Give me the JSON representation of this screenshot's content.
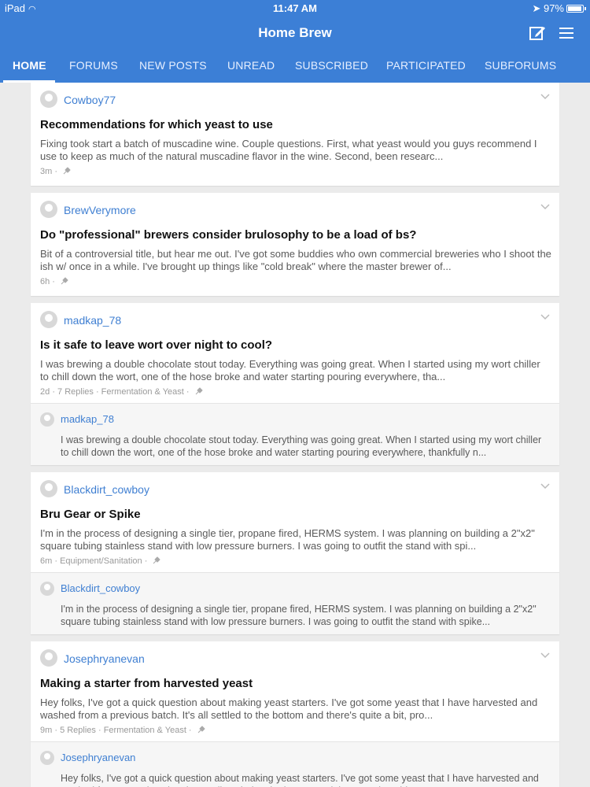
{
  "status_bar": {
    "device": "iPad",
    "time": "11:47 AM",
    "battery": "97%"
  },
  "header": {
    "title": "Home Brew"
  },
  "tabs": [
    "HOME",
    "FORUMS",
    "NEW POSTS",
    "UNREAD",
    "SUBSCRIBED",
    "PARTICIPATED",
    "SUBFORUMS"
  ],
  "posts": [
    {
      "user": "Cowboy77",
      "title": "Recommendations for which yeast to use",
      "preview": "Fixing took start a batch of muscadine wine. Couple questions. First, what yeast would you guys recommend I use to keep as much of the natural muscadine flavor in the wine. Second, been researc...",
      "time": "3m",
      "meta_extra": ""
    },
    {
      "user": "BrewVerymore",
      "title": "Do \"professional\" brewers consider brulosophy to be a load of bs?",
      "preview": "Bit of a controversial title, but hear me out. I've got some buddies who own commercial breweries who I shoot the ish w/ once in a while. I've brought up things like \"cold break\" where the master brewer of...",
      "time": "6h",
      "meta_extra": ""
    },
    {
      "user": "madkap_78",
      "title": "Is it safe to leave wort over night to cool?",
      "preview": "I was brewing a double chocolate stout today. Everything was going great. When I started using my wort chiller to chill down the wort, one of the hose broke and water starting pouring everywhere, tha...",
      "time": "2d",
      "meta_extra": "· 7 Replies · Fermentation & Yeast ·",
      "reply_user": "madkap_78",
      "reply_text": "I was brewing a double chocolate stout today. Everything was going great. When I started using my wort chiller to chill down the wort, one of the hose broke and water starting pouring everywhere, thankfully n..."
    },
    {
      "user": "Blackdirt_cowboy",
      "title": "Bru Gear or Spike",
      "preview": "I'm in the process of designing a single tier, propane fired, HERMS system. I was planning on building a 2\"x2\" square tubing stainless stand with low pressure burners. I was going to outfit the stand with spi...",
      "time": "6m",
      "meta_extra": "· Equipment/Sanitation ·",
      "reply_user": "Blackdirt_cowboy",
      "reply_text": "I'm in the process of designing a single tier, propane fired, HERMS system. I was planning on building a 2\"x2\" square tubing stainless stand with low pressure burners. I was going to outfit the stand with spike..."
    },
    {
      "user": "Josephryanevan",
      "title": "Making a starter from harvested yeast",
      "preview": "Hey folks, I've got a quick question about making yeast starters. I've got some yeast that I have harvested and washed from a previous batch. It's all settled to the bottom and there's quite a bit, pro...",
      "time": "9m",
      "meta_extra": "· 5 Replies · Fermentation & Yeast ·",
      "reply_user": "Josephryanevan",
      "reply_text": "Hey folks, I've got a quick question about making yeast starters. I've got some yeast that I have harvested and washed from a previous batch. It's all settled to the bottom and there's quite a bit, pro..."
    }
  ]
}
